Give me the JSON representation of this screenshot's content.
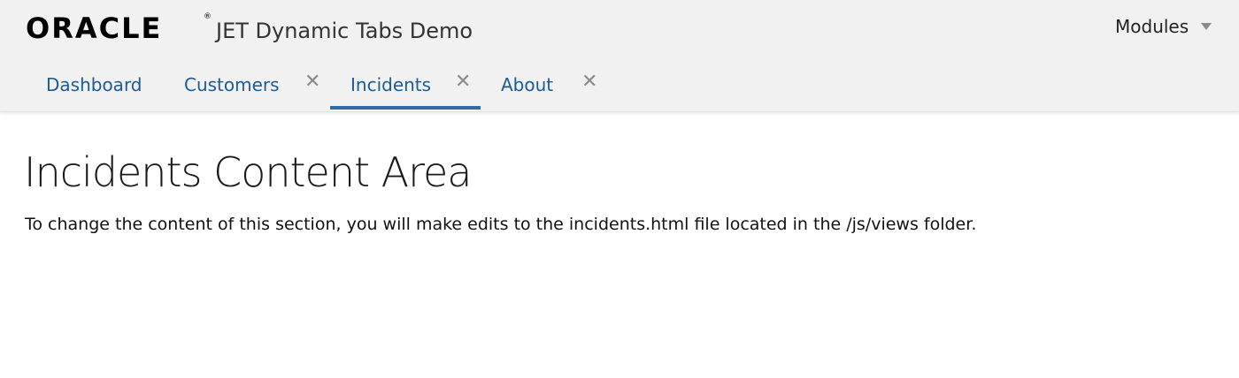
{
  "header": {
    "logo_text": "ORACLE",
    "logo_mark": "®",
    "app_title": "JET Dynamic Tabs Demo",
    "modules_label": "Modules",
    "modules_icon": "chevron-down-icon"
  },
  "tabs": [
    {
      "label": "Dashboard",
      "closable": false,
      "selected": false
    },
    {
      "label": "Customers",
      "closable": true,
      "selected": false,
      "close_glyph": "✕"
    },
    {
      "label": "Incidents",
      "closable": true,
      "selected": true,
      "close_glyph": "✕"
    },
    {
      "label": "About",
      "closable": true,
      "selected": false,
      "close_glyph": "✕"
    }
  ],
  "content": {
    "title": "Incidents Content Area",
    "description": "To change the content of this section, you will make edits to the incidents.html file located in the /js/views folder."
  },
  "colors": {
    "tab_text": "#1d5b95",
    "selected_bar": "#2f6ba7",
    "header_bg": "#f1f1f1"
  }
}
